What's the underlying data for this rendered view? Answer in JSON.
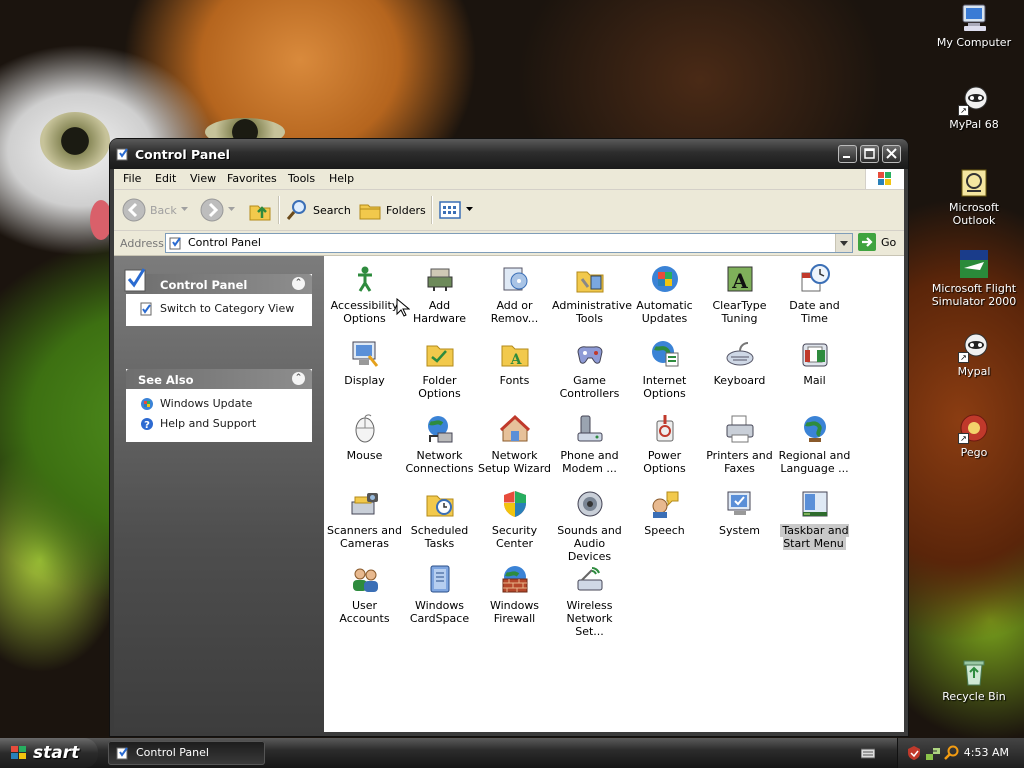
{
  "desktop": {
    "icons": [
      {
        "label": "My Computer",
        "icon": "my-computer-icon",
        "shortcut": false
      },
      {
        "label": "MyPal 68",
        "icon": "mypal-icon",
        "shortcut": true
      },
      {
        "label": "Microsoft Outlook",
        "icon": "outlook-icon",
        "shortcut": false
      },
      {
        "label": "Microsoft Flight Simulator 2000",
        "icon": "flight-simulator-icon",
        "shortcut": false
      },
      {
        "label": "Mypal",
        "icon": "mypal-icon",
        "shortcut": true
      },
      {
        "label": "Pego",
        "icon": "pego-icon",
        "shortcut": true
      },
      {
        "label": "Recycle Bin",
        "icon": "recycle-bin-icon",
        "shortcut": false
      }
    ]
  },
  "window": {
    "title": "Control Panel",
    "menu": [
      "File",
      "Edit",
      "View",
      "Favorites",
      "Tools",
      "Help"
    ],
    "toolbar": {
      "back": "Back",
      "search": "Search",
      "folders": "Folders"
    },
    "address": {
      "label": "Address",
      "value": "Control Panel",
      "go": "Go"
    },
    "left_pane": {
      "control_panel": {
        "title": "Control Panel",
        "links": [
          "Switch to Category View"
        ]
      },
      "see_also": {
        "title": "See Also",
        "links": [
          "Windows Update",
          "Help and Support"
        ]
      }
    },
    "items": [
      {
        "label": "Accessibility Options",
        "icon": "accessibility-icon"
      },
      {
        "label": "Add Hardware",
        "icon": "add-hardware-icon"
      },
      {
        "label": "Add or Remov...",
        "icon": "add-remove-programs-icon"
      },
      {
        "label": "Administrative Tools",
        "icon": "administrative-tools-icon"
      },
      {
        "label": "Automatic Updates",
        "icon": "automatic-updates-icon"
      },
      {
        "label": "ClearType Tuning",
        "icon": "cleartype-icon"
      },
      {
        "label": "Date and Time",
        "icon": "date-time-icon"
      },
      {
        "label": "Display",
        "icon": "display-icon"
      },
      {
        "label": "Folder Options",
        "icon": "folder-options-icon"
      },
      {
        "label": "Fonts",
        "icon": "fonts-icon"
      },
      {
        "label": "Game Controllers",
        "icon": "game-controllers-icon"
      },
      {
        "label": "Internet Options",
        "icon": "internet-options-icon"
      },
      {
        "label": "Keyboard",
        "icon": "keyboard-icon"
      },
      {
        "label": "Mail",
        "icon": "mail-icon"
      },
      {
        "label": "Mouse",
        "icon": "mouse-icon"
      },
      {
        "label": "Network Connections",
        "icon": "network-connections-icon"
      },
      {
        "label": "Network Setup Wizard",
        "icon": "network-setup-icon"
      },
      {
        "label": "Phone and Modem ...",
        "icon": "phone-modem-icon"
      },
      {
        "label": "Power Options",
        "icon": "power-options-icon"
      },
      {
        "label": "Printers and Faxes",
        "icon": "printers-faxes-icon"
      },
      {
        "label": "Regional and Language ...",
        "icon": "regional-language-icon"
      },
      {
        "label": "Scanners and Cameras",
        "icon": "scanners-cameras-icon"
      },
      {
        "label": "Scheduled Tasks",
        "icon": "scheduled-tasks-icon"
      },
      {
        "label": "Security Center",
        "icon": "security-center-icon"
      },
      {
        "label": "Sounds and Audio Devices",
        "icon": "sounds-audio-icon"
      },
      {
        "label": "Speech",
        "icon": "speech-icon"
      },
      {
        "label": "System",
        "icon": "system-icon"
      },
      {
        "label": "Taskbar and Start Menu",
        "icon": "taskbar-start-menu-icon",
        "selected": true
      },
      {
        "label": "User Accounts",
        "icon": "user-accounts-icon"
      },
      {
        "label": "Windows CardSpace",
        "icon": "cardspace-icon"
      },
      {
        "label": "Windows Firewall",
        "icon": "firewall-icon"
      },
      {
        "label": "Wireless Network Set...",
        "icon": "wireless-network-icon"
      }
    ]
  },
  "taskbar": {
    "start": "start",
    "task": "Control Panel",
    "clock": "4:53 AM"
  }
}
